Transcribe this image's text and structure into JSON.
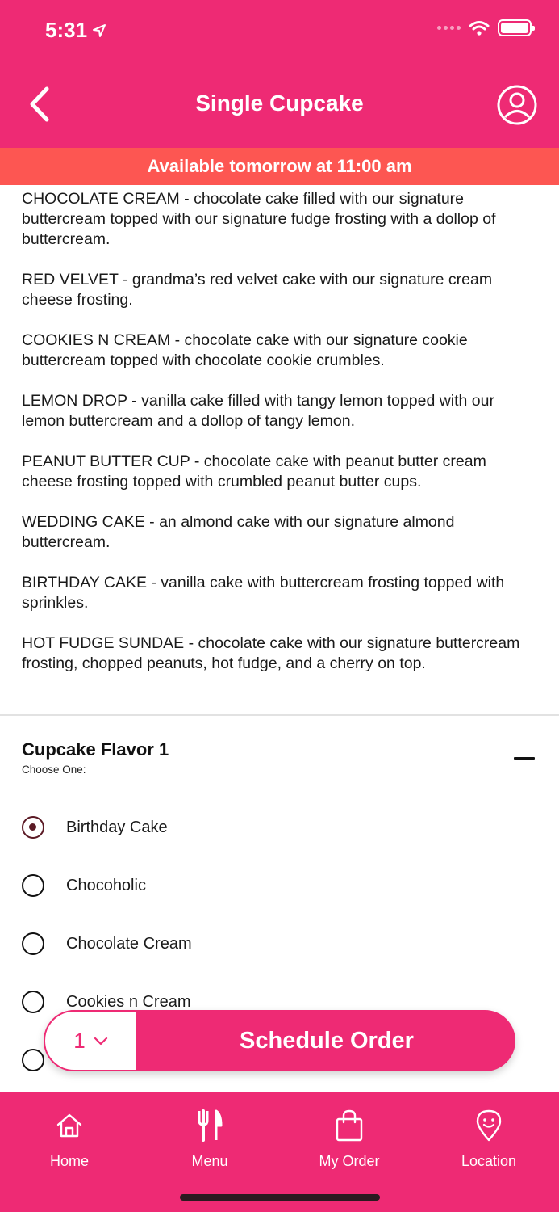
{
  "status_bar": {
    "time": "5:31"
  },
  "header": {
    "title": "Single Cupcake"
  },
  "banner": {
    "text": "Available tomorrow at 11:00 am"
  },
  "description": [
    "CHOCOLATE CREAM - chocolate cake filled with our signature buttercream topped with our signature fudge frosting with a dollop of buttercream.",
    "RED VELVET - grandma’s red velvet cake with our signature cream cheese frosting.",
    "COOKIES N CREAM - chocolate cake with our signature cookie buttercream topped with chocolate cookie crumbles.",
    "LEMON DROP - vanilla cake filled with tangy lemon topped with our lemon buttercream and a dollop of tangy lemon.",
    "PEANUT BUTTER CUP - chocolate cake with peanut butter cream cheese frosting topped with crumbled peanut butter cups.",
    "WEDDING CAKE - an almond cake with our signature almond buttercream.",
    "BIRTHDAY CAKE - vanilla cake with buttercream frosting topped with sprinkles.",
    "HOT FUDGE SUNDAE - chocolate cake with our signature buttercream frosting, chopped peanuts, hot fudge, and a cherry on top."
  ],
  "flavor_section": {
    "title": "Cupcake Flavor 1",
    "subtitle": "Choose One:",
    "options": [
      {
        "label": "Birthday Cake",
        "selected": true
      },
      {
        "label": "Chocoholic",
        "selected": false
      },
      {
        "label": "Chocolate Cream",
        "selected": false
      },
      {
        "label": "Cookies n Cream",
        "selected": false
      },
      {
        "label": "",
        "selected": false
      }
    ]
  },
  "order_bar": {
    "quantity": "1",
    "button_label": "Schedule Order"
  },
  "tabbar": {
    "items": [
      {
        "label": "Home",
        "icon": "home-icon"
      },
      {
        "label": "Menu",
        "icon": "utensils-icon"
      },
      {
        "label": "My Order",
        "icon": "shopping-bag-icon"
      },
      {
        "label": "Location",
        "icon": "location-pin-icon"
      }
    ]
  },
  "colors": {
    "brand": "#ee2a74",
    "banner": "#fd5652",
    "radio_selected": "#5b1a25"
  }
}
